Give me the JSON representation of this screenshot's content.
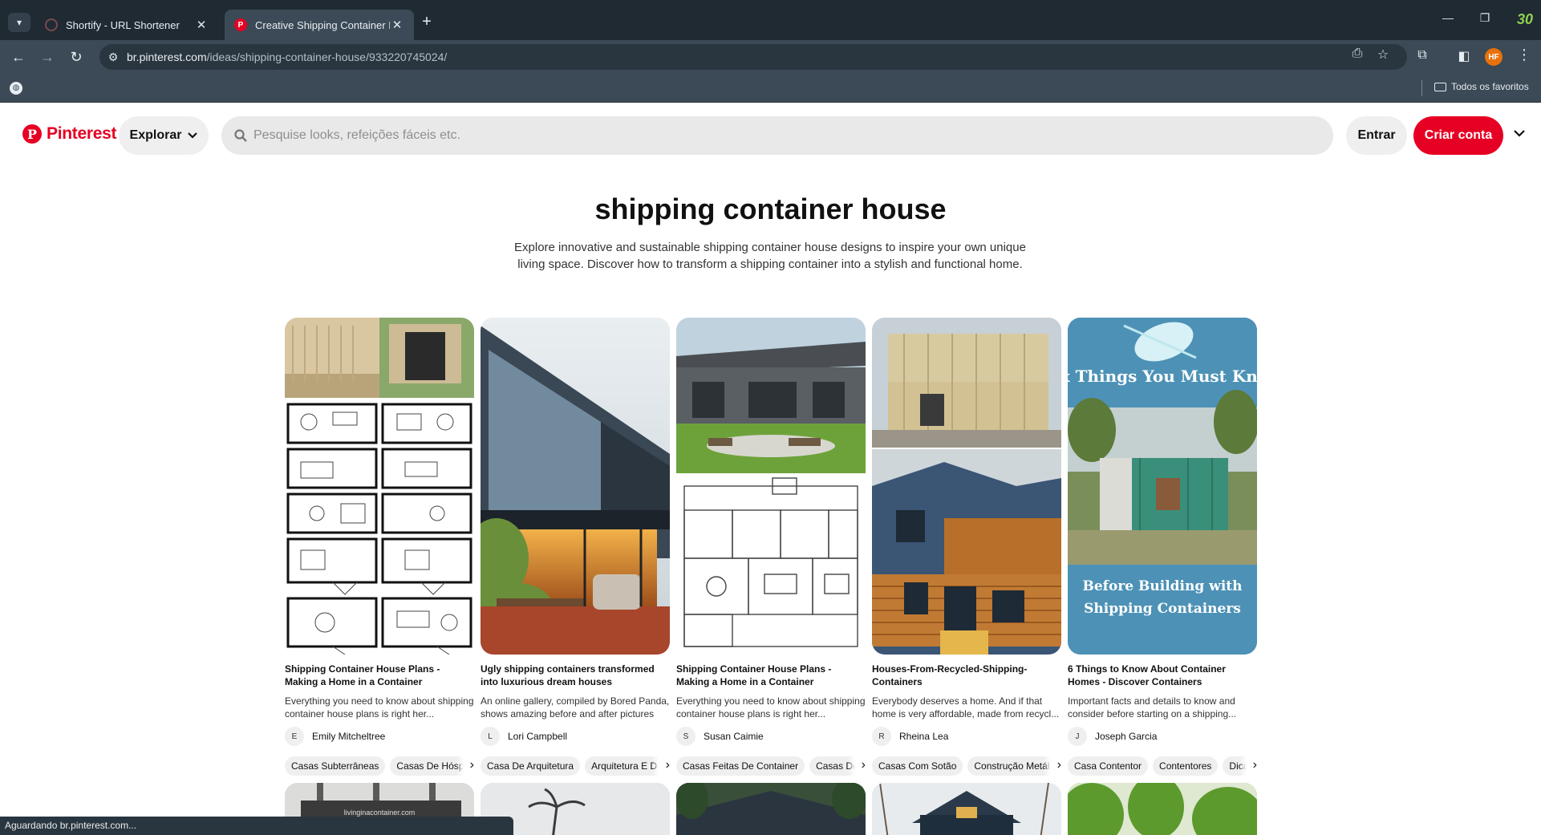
{
  "browser": {
    "tabs": [
      {
        "title": "Shortify - URL Shortener",
        "active": false
      },
      {
        "title": "Creative Shipping Container Ho",
        "active": true
      }
    ],
    "new_tab_symbol": "+",
    "extension_badge": "30",
    "url": {
      "host": "br.pinterest.com",
      "path": "/ideas/shipping-container-house/933220745024/"
    },
    "profile_initials": "HF",
    "bookmarks_folder": "Todos os favoritos",
    "status_text": "Aguardando br.pinterest.com..."
  },
  "header": {
    "logo_text": "Pinterest",
    "explore_label": "Explorar",
    "search_placeholder": "Pesquise looks, refeições fáceis etc.",
    "login_label": "Entrar",
    "signup_label": "Criar conta",
    "brand_color": "#e60023"
  },
  "page": {
    "title": "shipping container house",
    "description": "Explore innovative and sustainable shipping container house designs to inspire your own unique living space. Discover how to transform a shipping container into a stylish and functional home."
  },
  "pins": [
    {
      "title": "Shipping Container House Plans - Making a Home in a Container",
      "description": "Everything you need to know about shipping container house plans is right her...",
      "author_initial": "E",
      "author": "Emily Mitcheltree",
      "chips": [
        "Casas Subterrâneas",
        "Casas De Hóspe"
      ]
    },
    {
      "title": "Ugly shipping containers transformed into luxurious dream houses",
      "description": "An online gallery, compiled by Bored Panda, shows amazing before and after pictures o...",
      "author_initial": "L",
      "author": "Lori Campbell",
      "chips": [
        "Casa De Arquitetura",
        "Arquitetura E D"
      ]
    },
    {
      "title": "Shipping Container House Plans - Making a Home in a Container",
      "description": "Everything you need to know about shipping container house plans is right her...",
      "author_initial": "S",
      "author": "Susan Caimie",
      "chips": [
        "Casas Feitas De Container",
        "Casas De"
      ]
    },
    {
      "title": "Houses-From-Recycled-Shipping-Containers",
      "description": "Everybody deserves a home. And if that home is very affordable, made from recycl...",
      "author_initial": "R",
      "author": "Rheina Lea",
      "chips": [
        "Casas Com Sotão",
        "Construção Metál"
      ]
    },
    {
      "title": "6 Things to Know About Container Homes - Discover Containers",
      "description": "Important facts and details to know and consider before starting on a shipping...",
      "author_initial": "J",
      "author": "Joseph Garcia",
      "chips": [
        "Casa Contentor",
        "Contentores",
        "Dica"
      ],
      "image_text_top": "Six Things You Must Know",
      "image_text_bottom": "Before Building with Shipping Containers"
    }
  ],
  "next_row_watermark": "livinginacontainer.com"
}
